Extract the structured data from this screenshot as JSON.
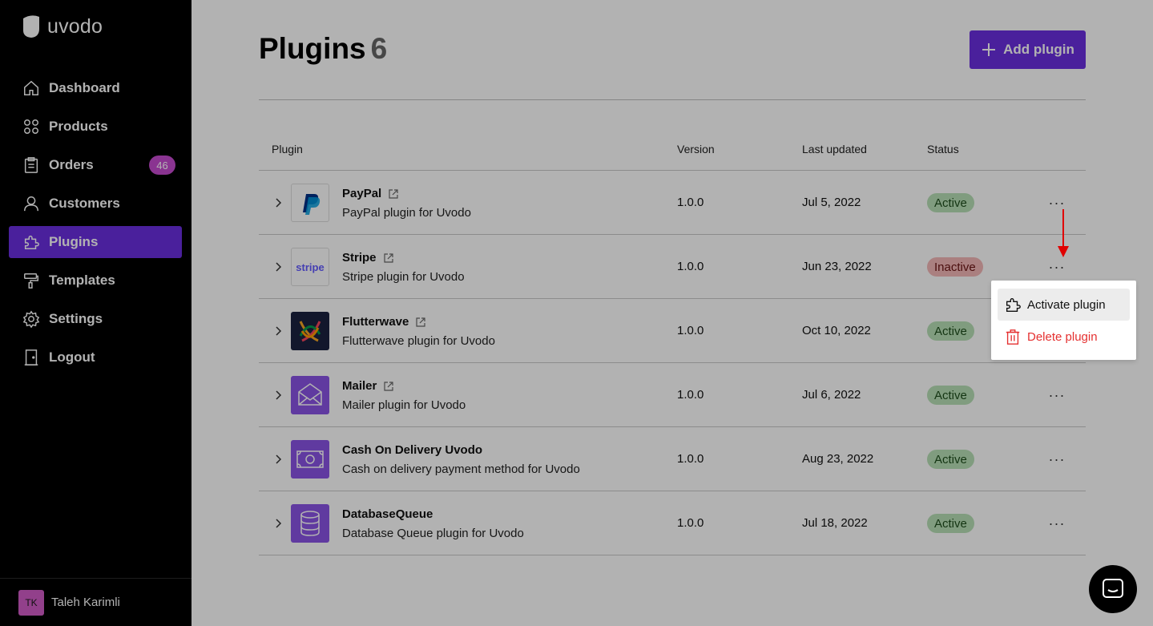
{
  "brand": {
    "name": "uvodo"
  },
  "sidebar": {
    "items": [
      {
        "label": "Dashboard",
        "icon": "home-icon"
      },
      {
        "label": "Products",
        "icon": "grid-icon"
      },
      {
        "label": "Orders",
        "icon": "clipboard-icon",
        "badge": "46"
      },
      {
        "label": "Customers",
        "icon": "user-icon"
      },
      {
        "label": "Plugins",
        "icon": "puzzle-icon",
        "active": true
      },
      {
        "label": "Templates",
        "icon": "paint-roller-icon"
      },
      {
        "label": "Settings",
        "icon": "gear-icon"
      },
      {
        "label": "Logout",
        "icon": "door-icon"
      }
    ],
    "user": {
      "initials": "TK",
      "name": "Taleh Karimli"
    }
  },
  "header": {
    "title": "Plugins",
    "count": "6",
    "add_button": "Add plugin"
  },
  "table": {
    "columns": [
      "Plugin",
      "Version",
      "Last updated",
      "Status"
    ],
    "rows": [
      {
        "name": "PayPal",
        "description": "PayPal plugin for Uvodo",
        "version": "1.0.0",
        "updated": "Jul 5, 2022",
        "status": "Active",
        "logo": "paypal-logo",
        "has_link": true
      },
      {
        "name": "Stripe",
        "description": "Stripe plugin for Uvodo",
        "version": "1.0.0",
        "updated": "Jun 23, 2022",
        "status": "Inactive",
        "logo": "stripe-logo",
        "logo_text": "stripe",
        "has_link": true
      },
      {
        "name": "Flutterwave",
        "description": "Flutterwave plugin for Uvodo",
        "version": "1.0.0",
        "updated": "Oct 10, 2022",
        "status": "Active",
        "logo": "flutterwave-logo",
        "has_link": true
      },
      {
        "name": "Mailer",
        "description": "Mailer plugin for Uvodo",
        "version": "1.0.0",
        "updated": "Jul 6, 2022",
        "status": "Active",
        "logo": "envelope-icon",
        "has_link": true
      },
      {
        "name": "Cash On Delivery Uvodo",
        "description": "Cash on delivery payment method for Uvodo",
        "version": "1.0.0",
        "updated": "Aug 23, 2022",
        "status": "Active",
        "logo": "cash-icon",
        "has_link": false
      },
      {
        "name": "DatabaseQueue",
        "description": "Database Queue plugin for Uvodo",
        "version": "1.0.0",
        "updated": "Jul 18, 2022",
        "status": "Active",
        "logo": "database-icon",
        "has_link": false
      }
    ]
  },
  "context_menu": {
    "items": [
      {
        "label": "Activate plugin",
        "icon": "puzzle-icon"
      },
      {
        "label": "Delete plugin",
        "icon": "trash-icon"
      }
    ]
  },
  "colors": {
    "accent": "#6a2fe0",
    "badge_pink": "#c64bd0",
    "status_active_bg": "#b8e0b6",
    "status_inactive_bg": "#f4b8b8",
    "danger": "#e53030",
    "annotation_arrow": "#e00000"
  }
}
